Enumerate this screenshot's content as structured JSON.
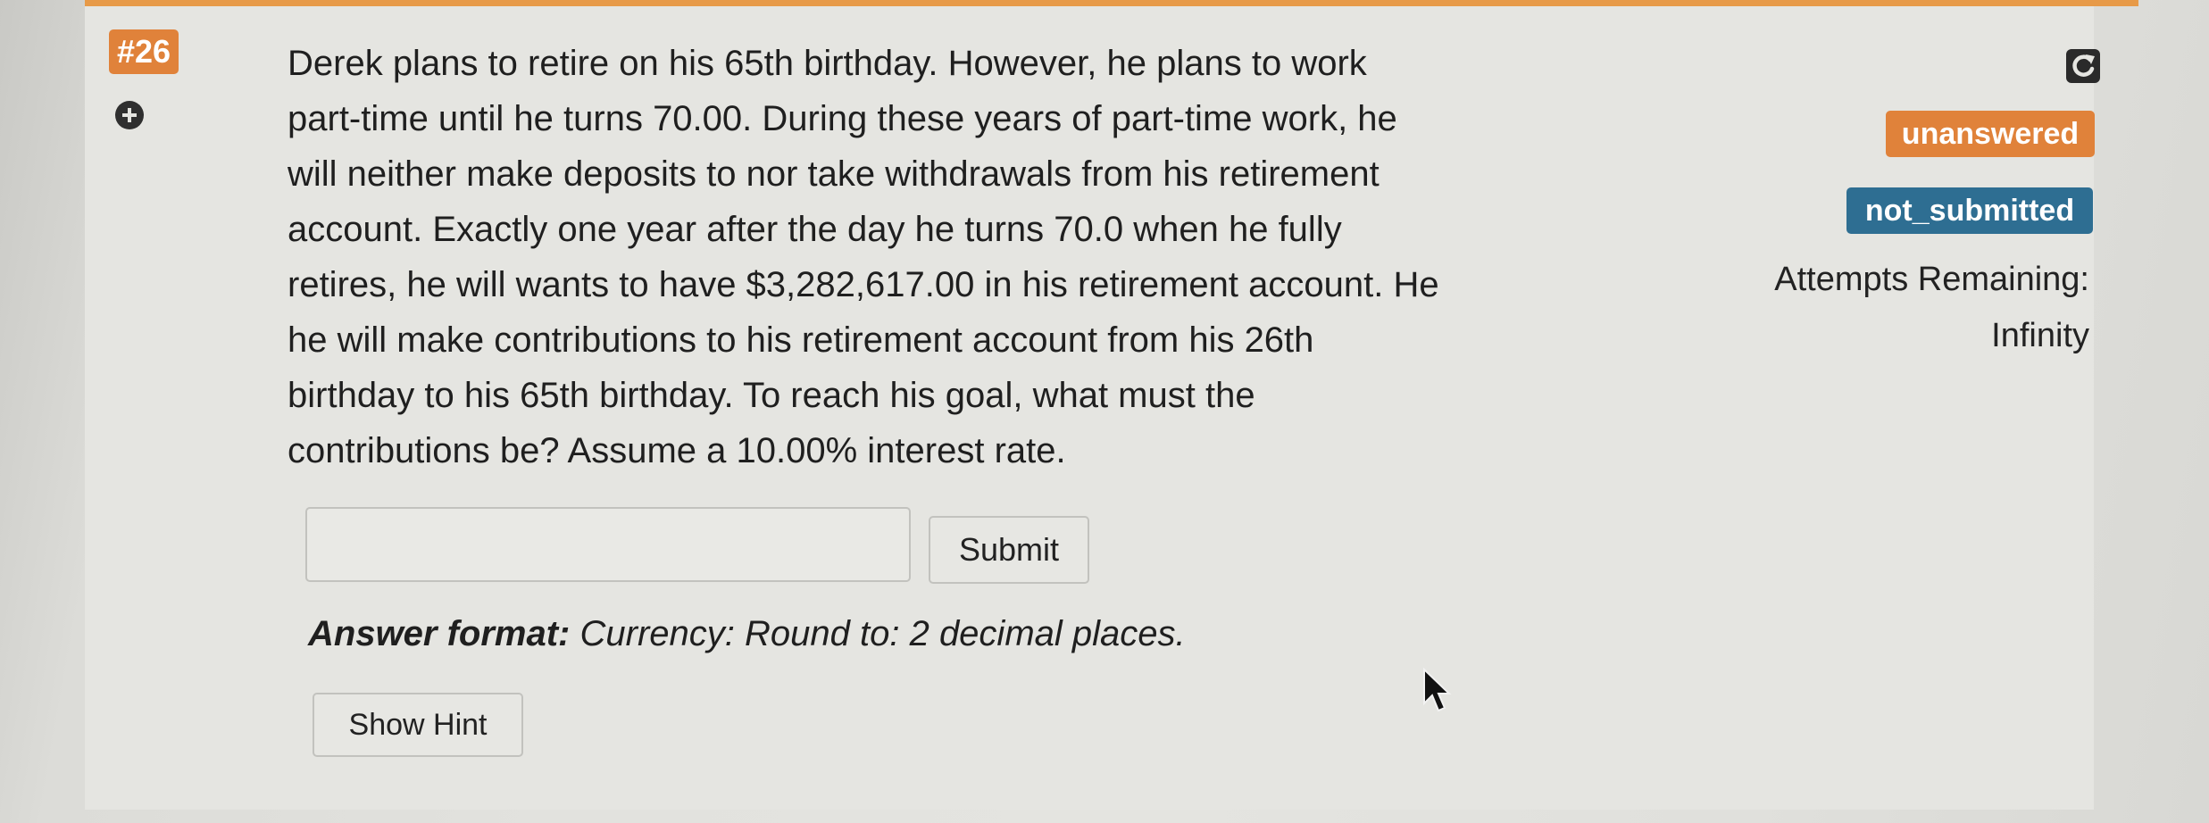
{
  "question": {
    "number": "#26",
    "lines": [
      "Derek plans to retire on his 65th birthday. However, he plans to work",
      "part-time until he turns 70.00. During these years of part-time work, he",
      "will neither make deposits to nor take withdrawals from his retirement",
      "account. Exactly one year after the day he turns 70.0 when he fully",
      "retires, he will wants to have $3,282,617.00 in his retirement account. He",
      "he will make contributions to his retirement account from his 26th",
      "birthday to his 65th birthday. To reach his goal, what must the",
      "contributions be? Assume a 10.00% interest rate."
    ]
  },
  "answer": {
    "input_value": "",
    "submit_label": "Submit",
    "format_label": "Answer format:",
    "format_text": "Currency: Round to: 2 decimal places.",
    "hint_label": "Show Hint"
  },
  "status": {
    "unanswered": "unanswered",
    "not_submitted": "not_submitted",
    "attempts_label": "Attempts Remaining:",
    "attempts_value": "Infinity"
  },
  "icons": {
    "expand": "plus-circle-icon",
    "refresh": "refresh-icon",
    "cursor": "mouse-pointer-icon"
  },
  "colors": {
    "accent_orange": "#e0823a",
    "badge_blue": "#2e6e92",
    "top_bar": "#e79a48"
  }
}
